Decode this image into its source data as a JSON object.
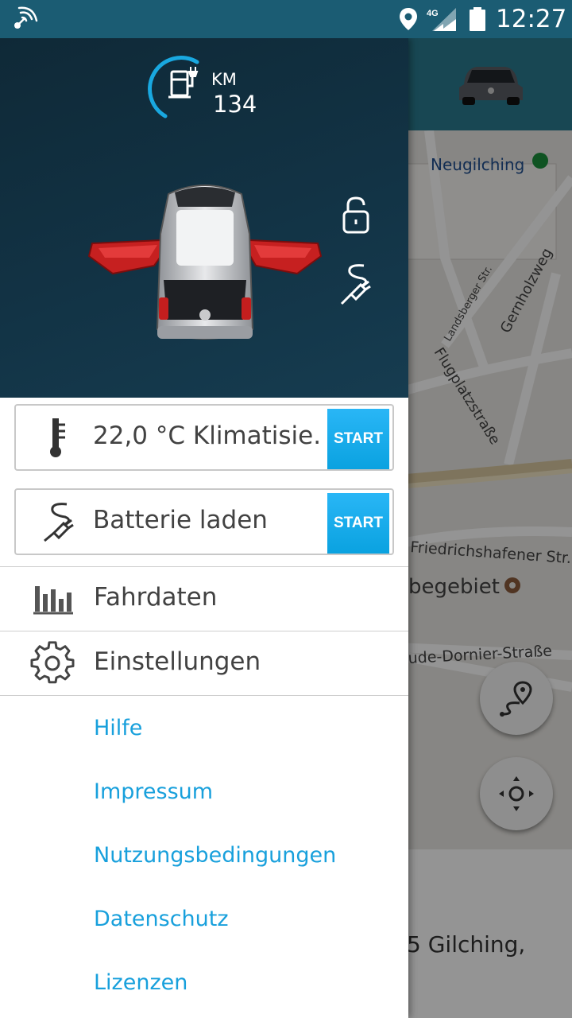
{
  "status_bar": {
    "time": "12:27",
    "network": "4G"
  },
  "drawer": {
    "range": {
      "label": "KM",
      "value": "134"
    },
    "climate": {
      "label": "22,0 °C Klimatisie..",
      "button": "START"
    },
    "battery": {
      "label": "Batterie laden",
      "button": "START"
    },
    "menu": {
      "fahrdaten": "Fahrdaten",
      "einstellungen": "Einstellungen"
    },
    "links": {
      "hilfe": "Hilfe",
      "impressum": "Impressum",
      "nutzungsbedingungen": "Nutzungsbedingungen",
      "datenschutz": "Datenschutz",
      "lizenzen": "Lizenzen"
    }
  },
  "map": {
    "labels": {
      "station": "Neugilching",
      "landsberger": "Landsberger Str.",
      "gernholzweg": "Gernholzweg",
      "flugplatz": "Flugplatzstraße",
      "friedrichshafener": "Friedrichshafener Str.",
      "gewerbe": "begebiet",
      "dornier": "ude-Dornier-Straße"
    },
    "address": "5 Gilching,"
  },
  "colors": {
    "accent": "#18a0dc",
    "header": "#123345",
    "statusbar": "#1b5c73",
    "start_button": "#29b6f6"
  }
}
